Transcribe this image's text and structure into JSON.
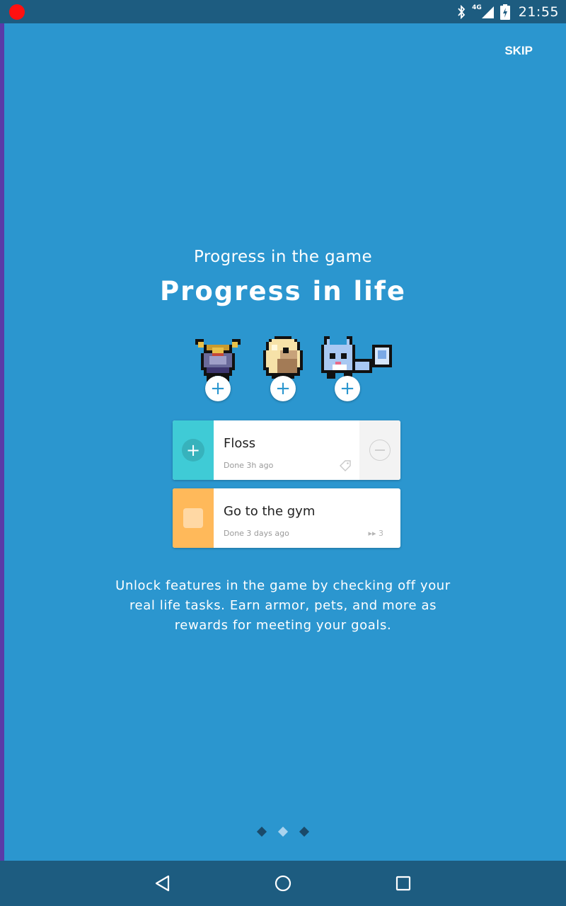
{
  "status_bar": {
    "network": "4G",
    "time": "21:55"
  },
  "onboarding": {
    "skip_label": "SKIP",
    "subheading": "Progress in the game",
    "heading": "Progress in life",
    "description": "Unlock features in the game by checking off your real life tasks. Earn armor, pets, and more as rewards for meeting your goals.",
    "rewards": [
      {
        "icon": "armor-sprite-icon",
        "badge": "+"
      },
      {
        "icon": "egg-sprite-icon",
        "badge": "+"
      },
      {
        "icon": "pet-sprite-icon",
        "badge": "+"
      }
    ],
    "tasks": [
      {
        "title": "Floss",
        "meta": "Done 3h ago",
        "color": "#3fcbd6"
      },
      {
        "title": "Go to the gym",
        "meta": "Done 3 days ago",
        "streak": "3",
        "color": "#ffb95a"
      }
    ],
    "page_indicator": {
      "count": 3,
      "active_index": 1
    }
  },
  "colors": {
    "background": "#2b96cf",
    "system_bar": "#1d5c80"
  }
}
